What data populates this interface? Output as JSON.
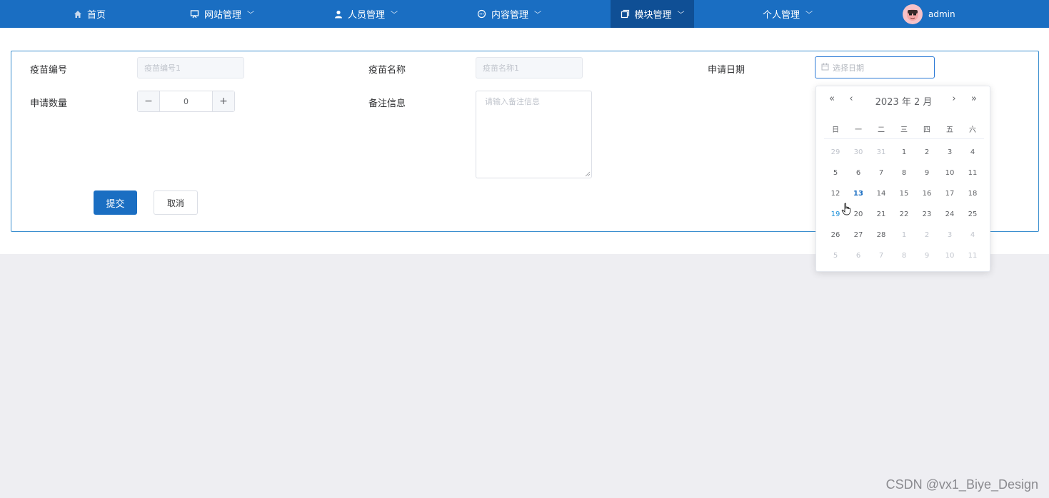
{
  "nav": {
    "items": [
      {
        "label": "首页",
        "icon": "home-icon"
      },
      {
        "label": "网站管理",
        "icon": "monitor-icon"
      },
      {
        "label": "人员管理",
        "icon": "user-icon"
      },
      {
        "label": "内容管理",
        "icon": "chat-icon"
      },
      {
        "label": "模块管理",
        "icon": "module-icon"
      },
      {
        "label": "个人管理",
        "icon": ""
      }
    ],
    "active_index": 4,
    "user_name": "admin"
  },
  "form": {
    "vaccine_code_label": "疫苗编号",
    "vaccine_code_placeholder": "疫苗编号1",
    "vaccine_name_label": "疫苗名称",
    "vaccine_name_placeholder": "疫苗名称1",
    "apply_date_label": "申请日期",
    "apply_date_placeholder": "选择日期",
    "quantity_label": "申请数量",
    "quantity_value": "0",
    "remark_label": "备注信息",
    "remark_placeholder": "请输入备注信息",
    "submit_label": "提交",
    "cancel_label": "取消"
  },
  "calendar": {
    "title": "2023 年  2 月",
    "weekdays": [
      "日",
      "一",
      "二",
      "三",
      "四",
      "五",
      "六"
    ],
    "weeks": [
      [
        "29",
        "30",
        "31",
        "1",
        "2",
        "3",
        "4"
      ],
      [
        "5",
        "6",
        "7",
        "8",
        "9",
        "10",
        "11"
      ],
      [
        "12",
        "13",
        "14",
        "15",
        "16",
        "17",
        "18"
      ],
      [
        "19",
        "20",
        "21",
        "22",
        "23",
        "24",
        "25"
      ],
      [
        "26",
        "27",
        "28",
        "1",
        "2",
        "3",
        "4"
      ],
      [
        "5",
        "6",
        "7",
        "8",
        "9",
        "10",
        "11"
      ]
    ],
    "today": "13",
    "hovered": "19"
  },
  "watermark": "CSDN @vx1_Biye_Design",
  "colors": {
    "primary": "#1a6ec2",
    "active_nav": "#0f4f95",
    "border": "#3b8fcf"
  }
}
